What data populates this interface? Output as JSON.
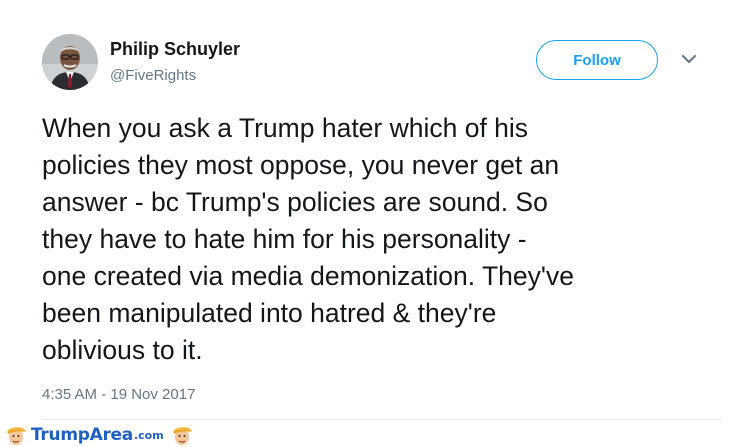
{
  "user": {
    "name": "Philip Schuyler",
    "handle": "@FiveRights"
  },
  "actions": {
    "follow_label": "Follow",
    "more_icon": "chevron-down-icon"
  },
  "tweet": {
    "text_lines": [
      "When you ask a Trump hater which of his",
      "policies they most oppose, you never get an",
      "answer - bc Trump's policies are sound. So",
      "they have to hate him for his personality -",
      "one created via media demonization. They've",
      "been manipulated into hatred & they're",
      "oblivious to it."
    ],
    "timestamp": "4:35 AM - 19 Nov 2017"
  },
  "watermark": {
    "brand": "TrumpArea",
    "domain": ".com",
    "icon": "trump-face-icon"
  },
  "colors": {
    "accent": "#1da1f2",
    "text": "#14171a",
    "muted": "#657786",
    "divider": "#e6ecf0",
    "watermark": "#1f5fbf"
  }
}
